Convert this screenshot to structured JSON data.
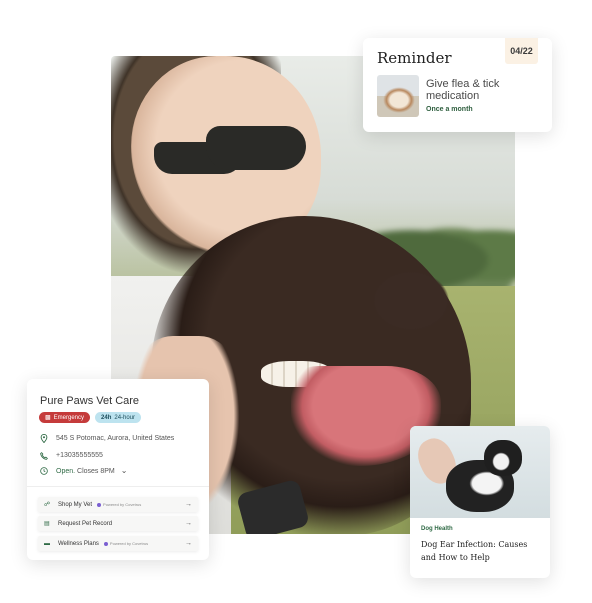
{
  "reminder": {
    "title": "Reminder",
    "date": "04/22",
    "task": "Give flea & tick medication",
    "frequency": "Once a month"
  },
  "vet": {
    "name": "Pure Paws Vet Care",
    "badges": {
      "emergency": "Emergency",
      "hours": "24-hour"
    },
    "address": "545 S Potomac, Aurora, United States",
    "phone": "+13035555555",
    "status_open": "Open.",
    "status_closes": "Closes 8PM",
    "actions": [
      {
        "label": "Shop My Vet",
        "powered": "Powered by Covetrus"
      },
      {
        "label": "Request Pet Record",
        "powered": ""
      },
      {
        "label": "Wellness Plans",
        "powered": "Powered by Covetrus"
      }
    ]
  },
  "article": {
    "tag": "Dog Health",
    "headline": "Dog Ear Infection: Causes and How to Help"
  },
  "colors": {
    "accent_green": "#2f6a45",
    "emergency_red": "#c53b3b",
    "hours_blue": "#bde3ef",
    "date_badge": "#fbf1e4"
  },
  "icons": {
    "location": "location-pin-icon",
    "phone": "phone-icon",
    "clock": "clock-icon",
    "chevron": "chevron-down-icon",
    "arrow": "arrow-right-icon"
  }
}
